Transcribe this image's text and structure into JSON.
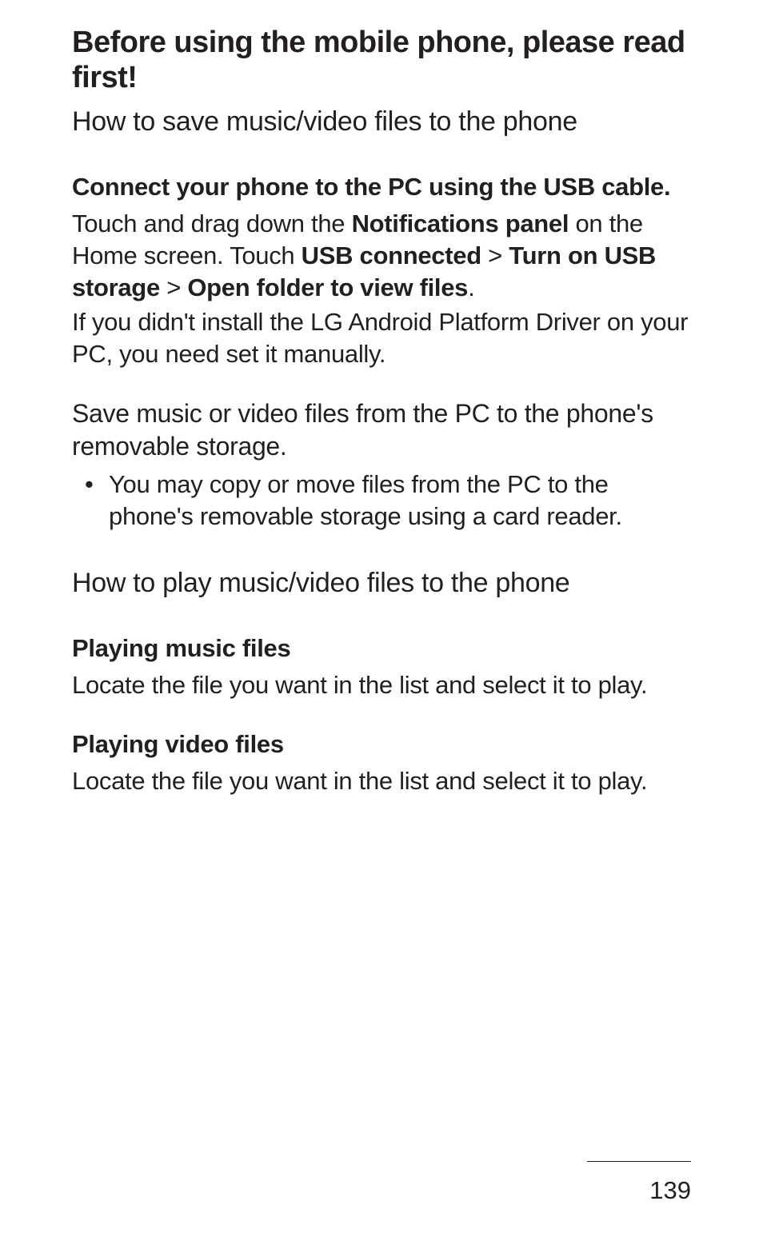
{
  "page_title": "Before using the mobile phone, please read first!",
  "section1": {
    "heading": "How to save music/video files to the phone",
    "sub1": "Connect your phone to the PC using the USB cable.",
    "p1_a": "Touch and drag down the ",
    "p1_b": "Notifications panel",
    "p1_c": " on the Home screen. Touch ",
    "p1_d": "USB connected",
    "p1_e": " > ",
    "p1_f": "Turn on USB storage",
    "p1_g": " > ",
    "p1_h": "Open folder to view files",
    "p1_i": ".",
    "p2": "If you didn't install the LG Android Platform Driver on your PC, you need set it manually.",
    "sub2": "Save music or video files from the PC to the phone's removable storage.",
    "bullet1": "You may copy or move files from the PC to the phone's removable storage using a card reader."
  },
  "section2": {
    "heading": "How to play music/video files to the phone",
    "sub1": "Playing music files",
    "p1": "Locate the file you want in the list and select it to play.",
    "sub2": "Playing video files",
    "p2": "Locate the file you want in the list and select it to play."
  },
  "page_number": "139"
}
